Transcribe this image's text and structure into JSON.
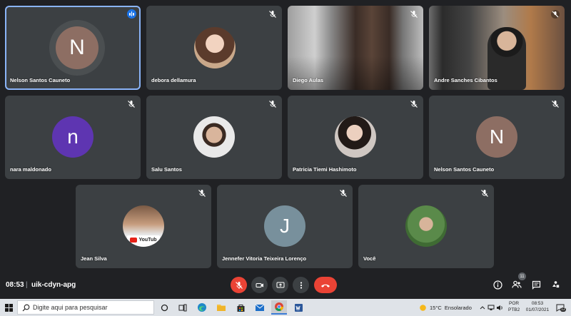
{
  "participants": [
    {
      "name": "Nelson Santos Cauneto",
      "initial": "N"
    },
    {
      "name": "debora dellamura"
    },
    {
      "name": "Diego Aulas"
    },
    {
      "name": "Andre Sanches Cibantos"
    },
    {
      "name": "nara maldonado",
      "initial": "n"
    },
    {
      "name": "Salu Santos"
    },
    {
      "name": "Patricia Tiemi Hashimoto"
    },
    {
      "name": "Nelson Santos Cauneto",
      "initial": "N"
    },
    {
      "name": "Jean Silva",
      "photo_text": "YouTub"
    },
    {
      "name": "Jennefer Vitoria Teixeira Lorenço",
      "initial": "J"
    },
    {
      "name": "Você"
    }
  ],
  "meeting": {
    "time": "08:53",
    "separator": "|",
    "code": "uik-cdyn-apg"
  },
  "participant_count": "11",
  "colors": {
    "background": "#202124",
    "tile": "#3c4043",
    "active_border": "#8ab4f8",
    "end_call": "#ea4335",
    "avatar_brown": "#8d6e63",
    "avatar_purple": "#5e35b1",
    "avatar_slate": "#78909c"
  },
  "taskbar": {
    "search_placeholder": "Digite aqui para pesquisar",
    "weather": "15°C  Ensolarado",
    "lang1": "POR",
    "lang2": "PTB2",
    "clock_time": "08:53",
    "clock_date": "01/07/2021",
    "notif_count": "12"
  }
}
